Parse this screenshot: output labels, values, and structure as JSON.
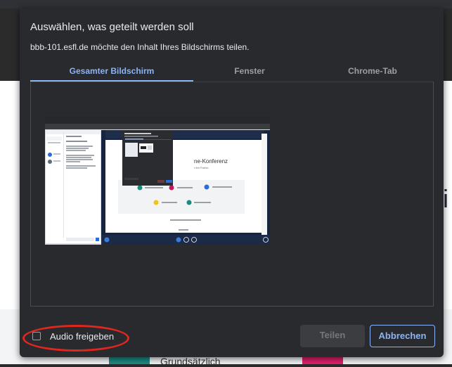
{
  "dialog": {
    "title": "Auswählen, was geteilt werden soll",
    "subtitle": "bbb-101.esfl.de möchte den Inhalt Ihres Bildschirms teilen.",
    "tabs": [
      {
        "label": "Gesamter Bildschirm",
        "active": true
      },
      {
        "label": "Fenster",
        "active": false
      },
      {
        "label": "Chrome-Tab",
        "active": false
      }
    ],
    "preview": {
      "heading": "ne-Konferenz",
      "subheading": "n Ihre Position"
    },
    "audio": {
      "label": "Audio freigeben",
      "checked": false
    },
    "buttons": {
      "share": "Teilen",
      "cancel": "Abbrechen"
    }
  },
  "background": {
    "letter": "i",
    "text": "Grundsätzlich"
  },
  "colors": {
    "accent": "#8ab4f8",
    "dialog_bg": "#292a2d",
    "annotation": "#e0261f"
  }
}
